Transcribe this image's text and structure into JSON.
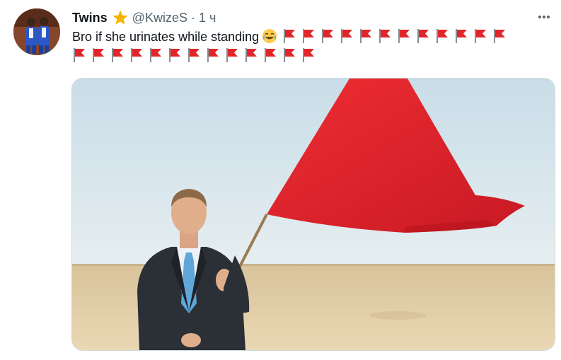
{
  "tweet": {
    "display_name": "Twins",
    "handle": "@KwizeS",
    "separator": "·",
    "time": "1 ч",
    "text": "Bro if she urinates while standing",
    "laugh_emoji": "face-with-tears-of-joy-icon",
    "flag_emoji": "triangular-red-flag-icon",
    "flags_line1": 12,
    "flags_line2": 13
  },
  "icons": {
    "verified": "star-badge-icon",
    "more": "more-horizontal-icon"
  },
  "colors": {
    "star": "#f4b400",
    "flag": "#e0262b",
    "media_flag": "#e3232c",
    "sky": "#d7e6ee",
    "sand": "#e4cfa6",
    "secondary_text": "#536471"
  }
}
